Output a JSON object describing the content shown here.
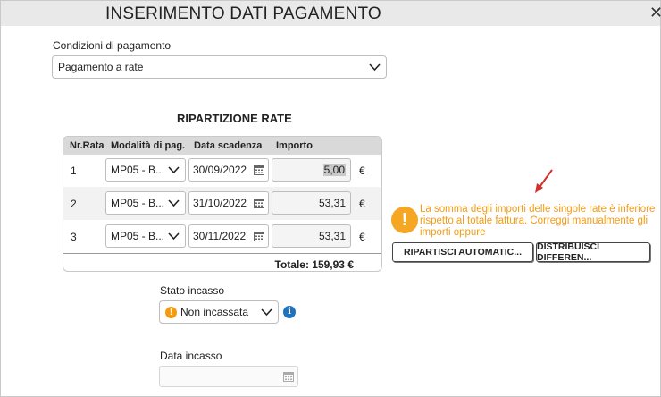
{
  "dialog": {
    "title": "INSERIMENTO DATI PAGAMENTO",
    "close_glyph": "✕"
  },
  "payment_conditions": {
    "label": "Condizioni di pagamento",
    "value": "Pagamento a rate"
  },
  "installments": {
    "section_title": "RIPARTIZIONE RATE",
    "columns": [
      "Nr.Rata",
      "Modalità di pag.",
      "Data scadenza",
      "Importo"
    ],
    "rows": [
      {
        "num": "1",
        "mode": "MP05 - B...",
        "date": "30/09/2022",
        "amount": "5,00",
        "currency": "€"
      },
      {
        "num": "2",
        "mode": "MP05 - B...",
        "date": "31/10/2022",
        "amount": "53,31",
        "currency": "€"
      },
      {
        "num": "3",
        "mode": "MP05 - B...",
        "date": "30/11/2022",
        "amount": "53,31",
        "currency": "€"
      }
    ],
    "total": "Totale: 159,93 €"
  },
  "warning": {
    "icon": "!",
    "text": "La somma degli importi delle singole rate è inferiore rispetto al totale fattura. Correggi manualmente gli importi oppure",
    "color": "#f39c12"
  },
  "actions": {
    "auto_split": "RIPARTISCI AUTOMATIC...",
    "distribute": "DISTRIBUISCI DIFFEREN..."
  },
  "collection_status": {
    "label": "Stato incasso",
    "value": "Non incassata",
    "status_icon": "!",
    "info_icon": "i"
  },
  "collection_date": {
    "label": "Data incasso",
    "value": ""
  },
  "icons": [
    "close-icon",
    "chevron-down-icon",
    "calendar-icon",
    "warning-icon",
    "info-icon",
    "red-arrow-icon"
  ]
}
